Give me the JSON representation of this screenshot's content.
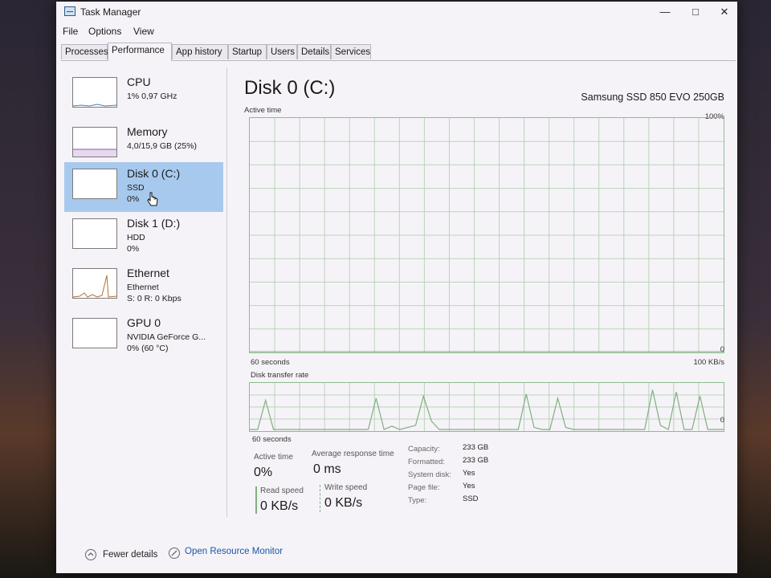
{
  "window": {
    "title": "Task Manager"
  },
  "menu": [
    "File",
    "Options",
    "View"
  ],
  "tabs": [
    "Processes",
    "Performance",
    "App history",
    "Startup",
    "Users",
    "Details",
    "Services"
  ],
  "active_tab": "Performance",
  "sidebar": [
    {
      "name": "CPU",
      "line1": "1% 0,97 GHz",
      "line2": ""
    },
    {
      "name": "Memory",
      "line1": "4,0/15,9 GB (25%)",
      "line2": ""
    },
    {
      "name": "Disk 0 (C:)",
      "line1": "SSD",
      "line2": "0%"
    },
    {
      "name": "Disk 1 (D:)",
      "line1": "HDD",
      "line2": "0%"
    },
    {
      "name": "Ethernet",
      "line1": "Ethernet",
      "line2": "S: 0 R: 0 Kbps"
    },
    {
      "name": "GPU 0",
      "line1": "NVIDIA GeForce G...",
      "line2": "0% (60 °C)"
    }
  ],
  "selected_index": 2,
  "main": {
    "title": "Disk 0 (C:)",
    "model": "Samsung SSD 850 EVO 250GB",
    "graph1": {
      "label": "Active time",
      "max": "100%",
      "min": "0",
      "time": "60 seconds"
    },
    "graph2": {
      "label": "Disk transfer rate",
      "max": "100 KB/s",
      "min": "0",
      "time": "60 seconds"
    },
    "stats": {
      "active_time_label": "Active time",
      "active_time_value": "0%",
      "avg_resp_label": "Average response time",
      "avg_resp_value": "0 ms",
      "read_label": "Read speed",
      "read_value": "0 KB/s",
      "write_label": "Write speed",
      "write_value": "0 KB/s"
    },
    "props": [
      {
        "k": "Capacity:",
        "v": "233 GB"
      },
      {
        "k": "Formatted:",
        "v": "233 GB"
      },
      {
        "k": "System disk:",
        "v": "Yes"
      },
      {
        "k": "Page file:",
        "v": "Yes"
      },
      {
        "k": "Type:",
        "v": "SSD"
      }
    ],
    "transfer_rate_samples": [
      0,
      0,
      70,
      0,
      0,
      0,
      0,
      0,
      0,
      0,
      0,
      0,
      0,
      0,
      0,
      0,
      75,
      0,
      8,
      0,
      5,
      10,
      80,
      20,
      0,
      0,
      0,
      0,
      0,
      0,
      0,
      0,
      0,
      0,
      0,
      85,
      5,
      0,
      0,
      75,
      5,
      0,
      0,
      0,
      0,
      0,
      0,
      0,
      0,
      0,
      0,
      95,
      10,
      0,
      90,
      0,
      0,
      80,
      0,
      0,
      0
    ]
  },
  "footer": {
    "fewer": "Fewer details",
    "monitor": "Open Resource Monitor"
  },
  "colors": {
    "graph_line": "#7fb07f",
    "grid": "#b8d4b8",
    "selected": "#a8c9ee"
  }
}
